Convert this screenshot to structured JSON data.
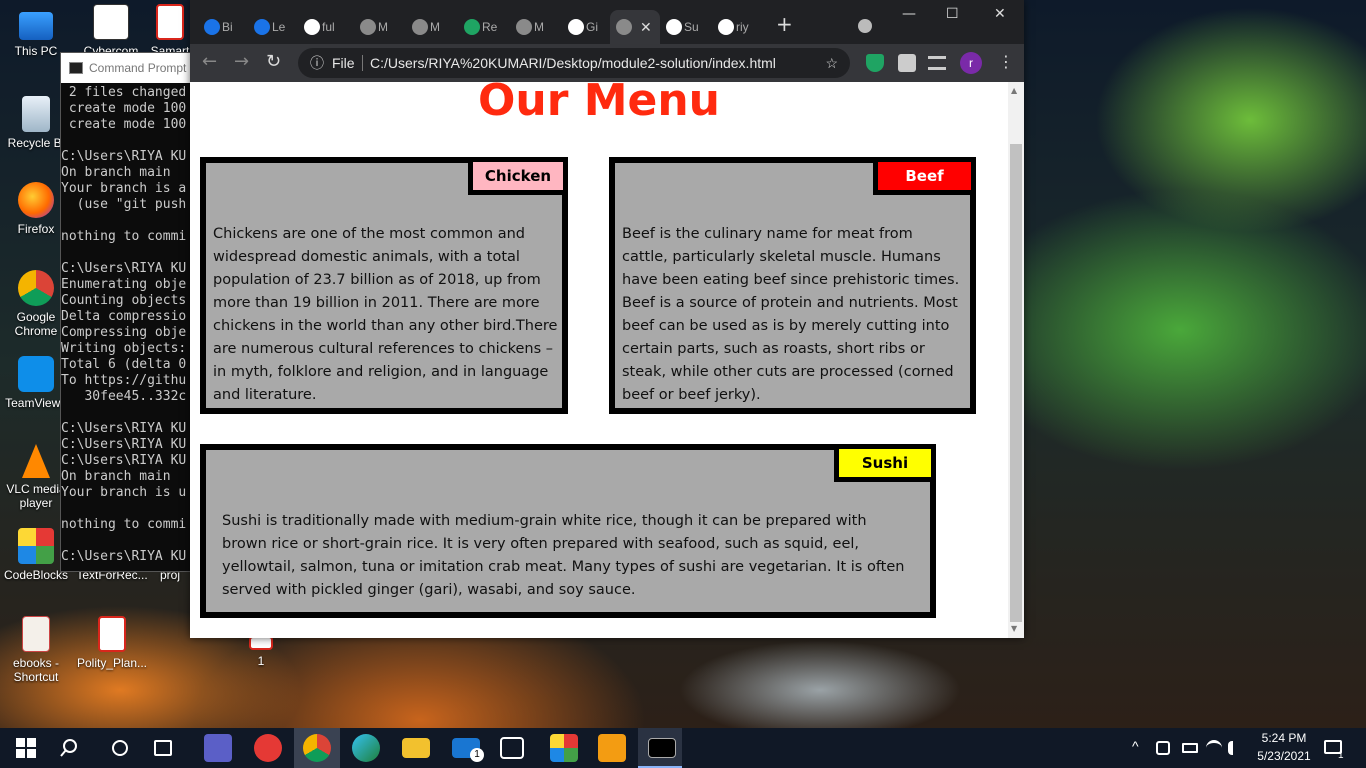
{
  "desktop": {
    "icons": [
      {
        "label": "This PC"
      },
      {
        "label": "Cybercom"
      },
      {
        "label": "Samart"
      },
      {
        "label": "Recycle Bi"
      },
      {
        "label": "Firefox"
      },
      {
        "label": "Google Chrome"
      },
      {
        "label": "TeamViewe"
      },
      {
        "label": "VLC media player"
      },
      {
        "label": "CodeBlocks"
      },
      {
        "label": "TextForRec..."
      },
      {
        "label": "proj"
      },
      {
        "label": "ebooks - Shortcut"
      },
      {
        "label": "Polity_Plan..."
      },
      {
        "label": "1"
      }
    ]
  },
  "cmd": {
    "title": "Command Prompt",
    "lines": [
      " 2 files changed",
      " create mode 100",
      " create mode 100",
      "",
      "C:\\Users\\RIYA KU",
      "On branch main",
      "Your branch is a",
      "  (use \"git push",
      "",
      "nothing to commi",
      "",
      "C:\\Users\\RIYA KU",
      "Enumerating obje",
      "Counting objects",
      "Delta compressio",
      "Compressing obje",
      "Writing objects:",
      "Total 6 (delta 0",
      "To https://githu",
      "   30fee45..332c",
      "",
      "C:\\Users\\RIYA KU",
      "C:\\Users\\RIYA KU",
      "C:\\Users\\RIYA KU",
      "On branch main",
      "Your branch is u",
      "",
      "nothing to commi",
      "",
      "C:\\Users\\RIYA KU"
    ]
  },
  "browser": {
    "tabs": [
      {
        "label": "Bi",
        "favicon_color": "#1a73e8"
      },
      {
        "label": "Le",
        "favicon_color": "#1a73e8"
      },
      {
        "label": "ful",
        "favicon_color": "#ffffff"
      },
      {
        "label": "M",
        "favicon_color": "#8a8a8a"
      },
      {
        "label": "M",
        "favicon_color": "#8a8a8a"
      },
      {
        "label": "Re",
        "favicon_color": "#1fa463"
      },
      {
        "label": "M",
        "favicon_color": "#8a8a8a"
      },
      {
        "label": "Gi",
        "favicon_color": "#ffffff"
      },
      {
        "label": "",
        "favicon_color": "#8a8a8a",
        "active": true
      },
      {
        "label": "Su",
        "favicon_color": "#ffffff"
      },
      {
        "label": "riy",
        "favicon_color": "#ffffff"
      }
    ],
    "new_tab": "+",
    "window_controls": {
      "minimize": "—",
      "maximize": "☐",
      "close": "✕"
    },
    "toolbar": {
      "back": "←",
      "forward": "→",
      "reload": "↻",
      "info_icon": "ⓘ",
      "scheme": "File",
      "url": "C:/Users/RIYA%20KUMARI/Desktop/module2-solution/index.html",
      "star": "☆",
      "profile_initial": "r"
    }
  },
  "page": {
    "title": "Our Menu",
    "cards": [
      {
        "label": "Chicken",
        "label_bg": "#ffb6c1",
        "label_color": "#000000",
        "text": "Chickens are one of the most common and widespread domestic animals, with a total population of 23.7 billion as of 2018, up from more than 19 billion in 2011. There are more chickens in the world than any other bird.There are numerous cultural references to chickens – in myth, folklore and religion, and in language and literature."
      },
      {
        "label": "Beef",
        "label_bg": "#ff0000",
        "label_color": "#ffffff",
        "text": "Beef is the culinary name for meat from cattle, particularly skeletal muscle. Humans have been eating beef since prehistoric times. Beef is a source of protein and nutrients. Most beef can be used as is by merely cutting into certain parts, such as roasts, short ribs or steak, while other cuts are processed (corned beef or beef jerky)."
      },
      {
        "label": "Sushi",
        "label_bg": "#ffff00",
        "label_color": "#000000",
        "text": "Sushi is traditionally made with medium-grain white rice, though it can be prepared with brown rice or short-grain rice. It is very often prepared with seafood, such as squid, eel, yellowtail, salmon, tuna or imitation crab meat. Many types of sushi are vegetarian. It is often served with pickled ginger (gari), wasabi, and soy sauce."
      }
    ]
  },
  "taskbar": {
    "time": "5:24 PM",
    "date": "5/23/2021",
    "mail_badge": "1",
    "notification_badge": "1"
  },
  "colors": {
    "title": "#ff2a0f",
    "card_bg": "#a9a9a9",
    "card_border": "#000000"
  }
}
